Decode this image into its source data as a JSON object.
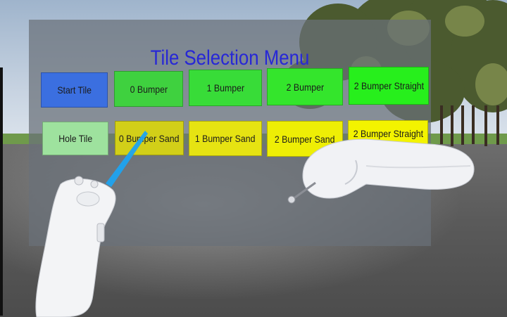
{
  "menu": {
    "title": "Tile Selection Menu",
    "rows": [
      [
        {
          "label": "Start Tile",
          "color": "#3b6fe0"
        },
        {
          "label": "0 Bumper",
          "color": "#3fd13f"
        },
        {
          "label": "1 Bumper",
          "color": "#38dc38"
        },
        {
          "label": "2 Bumper",
          "color": "#34e52c"
        },
        {
          "label": "2 Bumper Straight",
          "color": "#27ef1c"
        }
      ],
      [
        {
          "label": "Hole Tile",
          "color": "#9ee29e"
        },
        {
          "label": "0 Bumper Sand",
          "color": "#d2cf18"
        },
        {
          "label": "1 Bumper Sand",
          "color": "#e6e312"
        },
        {
          "label": "2 Bumper Sand",
          "color": "#eeee05"
        },
        {
          "label": "2 Bumper Straight",
          "color": "#f3f300"
        }
      ]
    ]
  },
  "controllers": {
    "left": "vr-controller",
    "right": "vr-controller",
    "pointer_color": "#1ea3f0"
  }
}
